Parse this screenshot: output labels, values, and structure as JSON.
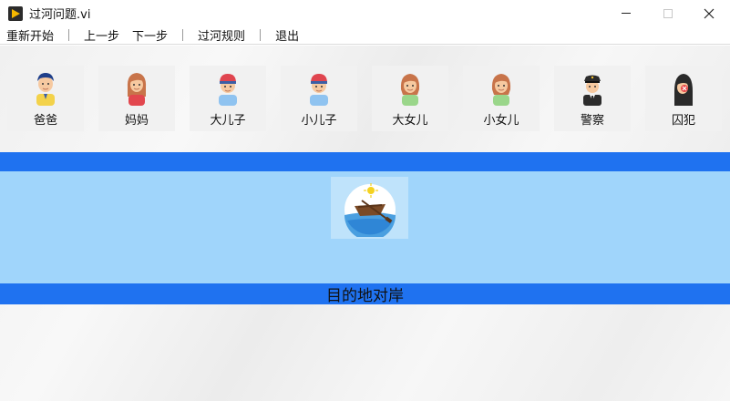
{
  "window": {
    "title": "过河问题.vi"
  },
  "menu": {
    "restart": "重新开始",
    "prev_step": "上一步",
    "next_step": "下一步",
    "rules": "过河规则",
    "exit": "退出"
  },
  "people": [
    {
      "label": "爸爸",
      "icon": "father-icon"
    },
    {
      "label": "妈妈",
      "icon": "mother-icon"
    },
    {
      "label": "大儿子",
      "icon": "elder-son-icon"
    },
    {
      "label": "小儿子",
      "icon": "younger-son-icon"
    },
    {
      "label": "大女儿",
      "icon": "elder-daughter-icon"
    },
    {
      "label": "小女儿",
      "icon": "younger-daughter-icon"
    },
    {
      "label": "警察",
      "icon": "police-icon"
    },
    {
      "label": "囚犯",
      "icon": "prisoner-icon"
    }
  ],
  "river": {
    "destination_label": "目的地对岸",
    "boat_icon": "boat-icon"
  },
  "colors": {
    "bank": "#1f72f0",
    "water": "#a0d5fb"
  }
}
